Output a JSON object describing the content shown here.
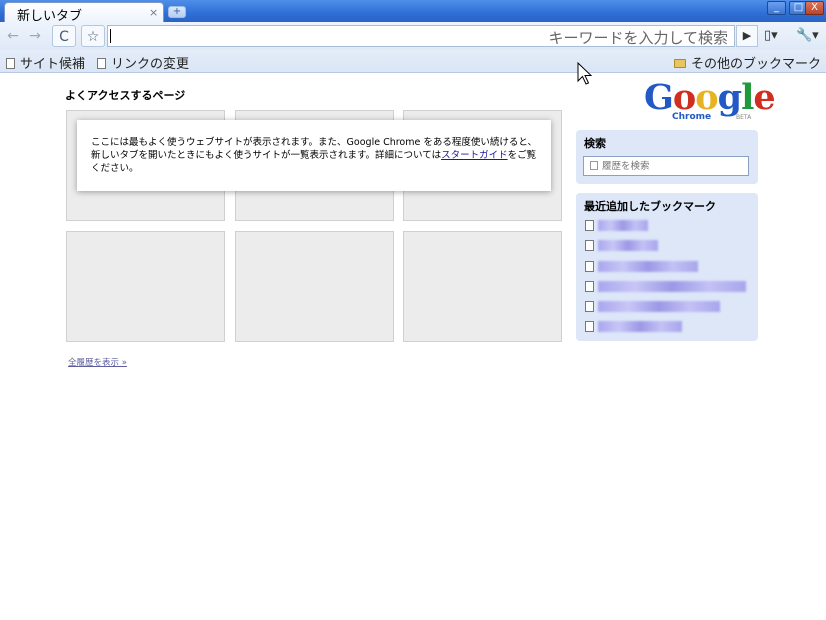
{
  "browser": {
    "tab_title": "新しいタブ",
    "tab_close": "×",
    "new_tab": "+",
    "window_buttons": {
      "minimize": "_",
      "maximize": "□",
      "close": "X"
    }
  },
  "toolbar": {
    "back": "←",
    "forward": "→",
    "reload": "C",
    "star": "☆",
    "omnibox_hint": "キーワードを入力して検索",
    "go": "▶",
    "page_menu": "▯▾",
    "tools_menu": "🔧▾"
  },
  "bookmarks_bar": {
    "items": [
      {
        "label": "サイト候補"
      },
      {
        "label": "リンクの変更"
      }
    ],
    "other_bookmarks": "その他のブックマーク"
  },
  "most_visited": {
    "title": "よくアクセスするページ",
    "notice": {
      "text_before_link": "ここには最もよく使うウェブサイトが表示されます。また、Google Chrome をある程度使い続けると、新しいタブを開いたときにもよく使うサイトが一覧表示されます。詳細については",
      "link": "スタートガイド",
      "text_after_link": "をご覧ください。"
    },
    "show_all_history": "全履歴を表示 »"
  },
  "logo": {
    "word": "Google",
    "product": "Chrome",
    "badge": "BETA"
  },
  "search_panel": {
    "title": "検索",
    "placeholder": "履歴を検索"
  },
  "recent_bookmarks": {
    "title": "最近追加したブックマーク",
    "item_count_visible": 6
  },
  "colors": {
    "tabstrip": "#2f6fd6",
    "panel": "#dde7f8",
    "thumbnail": "#ececec",
    "link": "#1a1a99"
  }
}
